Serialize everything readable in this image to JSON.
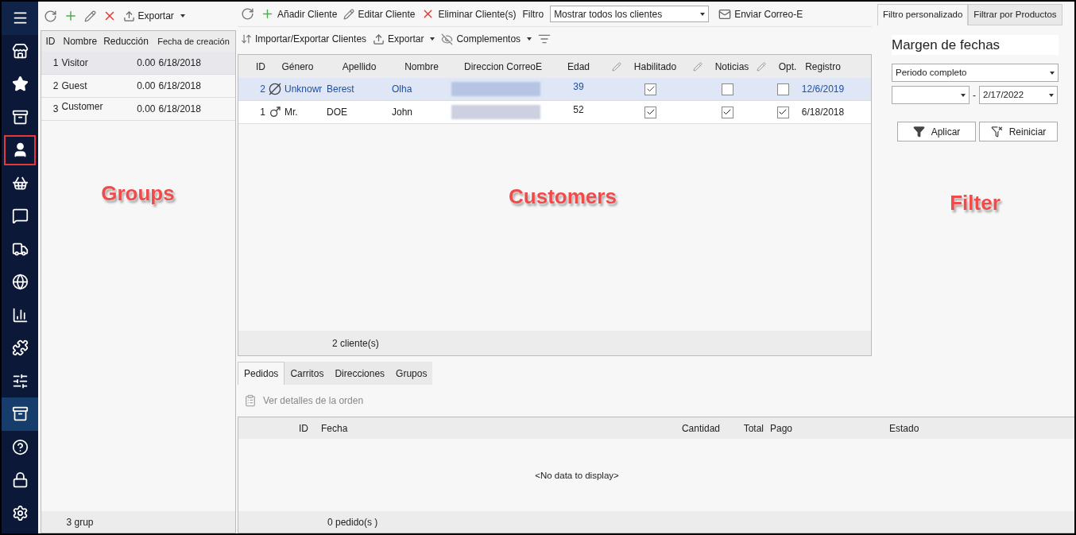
{
  "sidebar": {
    "items": [
      {
        "selected": false,
        "highlighted": false
      },
      {
        "selected": false,
        "highlighted": false
      },
      {
        "selected": false,
        "highlighted": false
      },
      {
        "selected": false,
        "highlighted": false
      },
      {
        "selected": false,
        "highlighted": true
      },
      {
        "selected": false,
        "highlighted": false
      },
      {
        "selected": false,
        "highlighted": false
      },
      {
        "selected": false,
        "highlighted": false
      },
      {
        "selected": false,
        "highlighted": false
      },
      {
        "selected": false,
        "highlighted": false
      },
      {
        "selected": false,
        "highlighted": false
      },
      {
        "selected": false,
        "highlighted": false
      },
      {
        "selected": true,
        "highlighted": false
      },
      {
        "selected": false,
        "highlighted": false
      },
      {
        "selected": false,
        "highlighted": false
      },
      {
        "selected": false,
        "highlighted": false
      }
    ]
  },
  "groups": {
    "toolbar": {
      "export": "Exportar"
    },
    "columns": [
      "ID",
      "Nombre",
      "Reducción",
      "Fecha de creación"
    ],
    "rows": [
      {
        "id": "1",
        "name": "Visitor",
        "discount": "0.00",
        "created": "6/18/2018",
        "selected": true
      },
      {
        "id": "2",
        "name": "Guest",
        "discount": "0.00",
        "created": "6/18/2018",
        "selected": false
      },
      {
        "id": "3",
        "name": "Customer",
        "discount": "0.00",
        "created": "6/18/2018",
        "selected": false
      }
    ],
    "footer": "3 grup",
    "annotation": "Groups"
  },
  "customers": {
    "toolbar1": {
      "add": "Añadir Cliente",
      "edit": "Editar Cliente",
      "delete": "Eliminar Cliente(s)",
      "filter_label": "Filtro",
      "filter_value": "Mostrar todos los clientes",
      "email": "Enviar Correo-E"
    },
    "toolbar2": {
      "import": "Importar/Exportar Clientes",
      "export": "Exportar",
      "addons": "Complementos"
    },
    "columns": [
      {
        "label": "ID",
        "editable": false
      },
      {
        "label": "Género",
        "editable": false
      },
      {
        "label": "Apellido",
        "editable": false
      },
      {
        "label": "Nombre",
        "editable": false
      },
      {
        "label": "Direccion CorreoE",
        "editable": false
      },
      {
        "label": "Edad",
        "editable": false
      },
      {
        "label": "Habilitado",
        "editable": true
      },
      {
        "label": "Noticias",
        "editable": true
      },
      {
        "label": "Opt.",
        "editable": true
      },
      {
        "label": "Registro",
        "editable": false
      }
    ],
    "rows": [
      {
        "id": "2",
        "kind": "unknown",
        "title": "Unknowr",
        "last": "Berest",
        "first": "Olha",
        "age": "39",
        "enabled": true,
        "news": false,
        "opt": false,
        "registered": "12/6/2019",
        "selected": true
      },
      {
        "id": "1",
        "kind": "male",
        "title": "Mr.",
        "last": "DOE",
        "first": "John",
        "age": "52",
        "enabled": true,
        "news": true,
        "opt": true,
        "registered": "6/18/2018",
        "selected": false
      }
    ],
    "footer": "2 cliente(s)",
    "annotation": "Customers"
  },
  "filter": {
    "tabs": [
      {
        "label": "Filtro personalizado",
        "selected": true
      },
      {
        "label": "Filtrar por Productos",
        "selected": false
      }
    ],
    "heading": "Margen de fechas",
    "period": "Periodo completo",
    "date_separator": "-",
    "date_to": "2/17/2022",
    "apply": "Aplicar",
    "reset": "Reiniciar",
    "annotation": "Filter"
  },
  "details": {
    "tabs": [
      {
        "label": "Pedidos",
        "selected": true
      },
      {
        "label": "Carritos",
        "selected": false
      },
      {
        "label": "Direcciones",
        "selected": false
      },
      {
        "label": "Grupos",
        "selected": false
      }
    ],
    "view_order": "Ver detalles de la orden",
    "columns": [
      "ID",
      "Fecha",
      "Cantidad",
      "Total",
      "Pago",
      "Estado"
    ],
    "empty": "<No data to display>",
    "footer": "0 pedido(s )"
  }
}
